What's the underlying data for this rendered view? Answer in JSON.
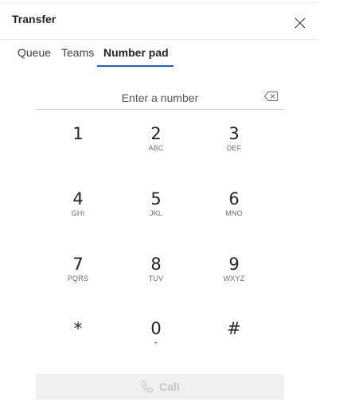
{
  "header": {
    "title": "Transfer",
    "close_icon": "close-icon"
  },
  "tabs": [
    {
      "label": "Queue",
      "selected": false
    },
    {
      "label": "Teams",
      "selected": false
    },
    {
      "label": "Number pad",
      "selected": true
    }
  ],
  "number_input": {
    "value": "",
    "placeholder": "Enter a number",
    "clear_icon": "backspace-icon"
  },
  "keypad": [
    {
      "digit": "1",
      "letters": ""
    },
    {
      "digit": "2",
      "letters": "ABC"
    },
    {
      "digit": "3",
      "letters": "DEF"
    },
    {
      "digit": "4",
      "letters": "GHI"
    },
    {
      "digit": "5",
      "letters": "JKL"
    },
    {
      "digit": "6",
      "letters": "MNO"
    },
    {
      "digit": "7",
      "letters": "PQRS"
    },
    {
      "digit": "8",
      "letters": "TUV"
    },
    {
      "digit": "9",
      "letters": "WXYZ"
    },
    {
      "digit": "*",
      "letters": ""
    },
    {
      "digit": "0",
      "letters": "+"
    },
    {
      "digit": "#",
      "letters": ""
    }
  ],
  "call_button": {
    "label": "Call",
    "icon": "phone-icon",
    "enabled": false
  },
  "colors": {
    "accent": "#1f5fbf",
    "text_primary": "#242424",
    "text_secondary": "#6e6e6e",
    "disabled_bg": "#f0f0f0",
    "disabled_text": "#c4c4c4"
  }
}
